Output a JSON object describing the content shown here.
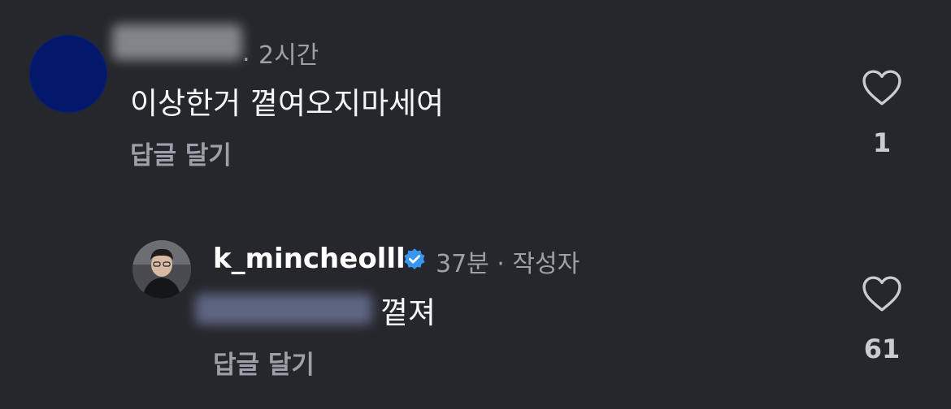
{
  "comment": {
    "time": "2시간",
    "text": "이상한거 꼍여오지마세여",
    "reply_label": "답글 달기",
    "likes": "1"
  },
  "reply": {
    "username": "k_mincheolll",
    "time_author": "37분 · 작성자",
    "text": "꼍져",
    "reply_label": "답글 달기",
    "likes": "61"
  },
  "colors": {
    "background": "#25272c",
    "avatar": "#03186b",
    "verified": "#3797f0",
    "muted_text": "#9ca0a8"
  }
}
